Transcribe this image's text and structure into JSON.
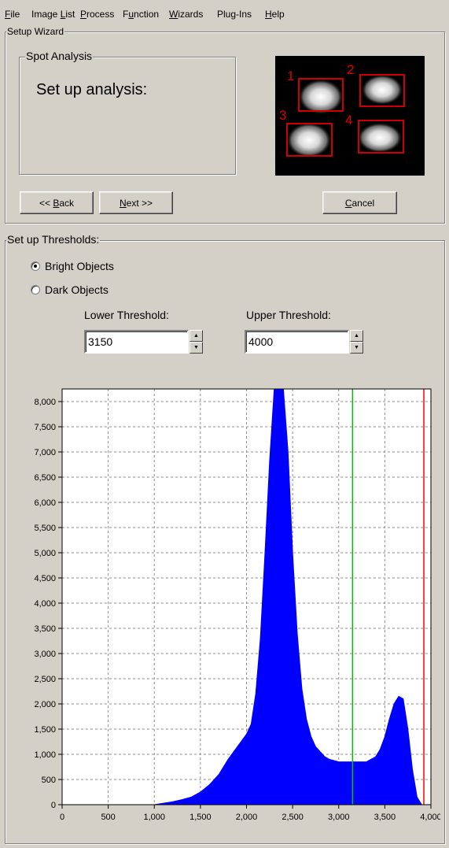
{
  "menu": [
    {
      "key": "file",
      "pre": "",
      "acc": "F",
      "post": "ile"
    },
    {
      "key": "image-list",
      "pre": "Image ",
      "acc": "L",
      "post": "ist"
    },
    {
      "key": "process",
      "pre": "",
      "acc": "P",
      "post": "rocess"
    },
    {
      "key": "function",
      "pre": "F",
      "acc": "u",
      "post": "nction"
    },
    {
      "key": "wizards",
      "pre": "",
      "acc": "W",
      "post": "izards"
    },
    {
      "key": "plugins",
      "pre": "Plug-Ins",
      "acc": "",
      "post": ""
    },
    {
      "key": "help",
      "pre": "",
      "acc": "H",
      "post": "elp"
    }
  ],
  "wizard": {
    "title": "Setup Wizard",
    "spot_group_title": "Spot Analysis",
    "instruction": "Set up analysis:",
    "preview_labels": [
      "1",
      "2",
      "3",
      "4"
    ],
    "back": {
      "pre": "<< ",
      "acc": "B",
      "post": "ack"
    },
    "next": {
      "pre": "",
      "acc": "N",
      "post": "ext >>"
    },
    "cancel": {
      "pre": "",
      "acc": "C",
      "post": "ancel"
    }
  },
  "thresholds": {
    "title": "Set up Thresholds:",
    "bright_label": "Bright Objects",
    "dark_label": "Dark Objects",
    "bright_selected": true,
    "lower_label": "Lower Threshold:",
    "upper_label": "Upper Threshold:",
    "lower_value": "3150",
    "upper_value": "4000"
  },
  "colors": {
    "histogram_fill": "#0000ff",
    "lower_line": "#00c000",
    "upper_line": "#ff0000",
    "preview_box": "#cc0000"
  },
  "chart_data": {
    "type": "area",
    "xlim": [
      0,
      4000
    ],
    "ylim": [
      0,
      8250
    ],
    "xticks": [
      0,
      500,
      1000,
      1500,
      2000,
      2500,
      3000,
      3500,
      4000
    ],
    "xtick_labels": [
      "0",
      "500",
      "1,000",
      "1,500",
      "2,000",
      "2,500",
      "3,000",
      "3,500",
      "4,000"
    ],
    "yticks": [
      0,
      500,
      1000,
      1500,
      2000,
      2500,
      3000,
      3500,
      4000,
      4500,
      5000,
      5500,
      6000,
      6500,
      7000,
      7500,
      8000
    ],
    "ytick_labels": [
      "0",
      "500",
      "1,000",
      "1,500",
      "2,000",
      "2,500",
      "3,000",
      "3,500",
      "4,000",
      "4,500",
      "5,000",
      "5,500",
      "6,000",
      "6,500",
      "7,000",
      "7,500",
      "8,000"
    ],
    "grid": true,
    "lower_threshold": 3150,
    "upper_threshold": 4000,
    "x": [
      0,
      1000,
      1100,
      1200,
      1300,
      1400,
      1500,
      1600,
      1700,
      1800,
      1900,
      2000,
      2050,
      2100,
      2150,
      2200,
      2250,
      2300,
      2350,
      2400,
      2450,
      2500,
      2550,
      2600,
      2650,
      2700,
      2750,
      2800,
      2850,
      2900,
      3000,
      3100,
      3200,
      3300,
      3400,
      3450,
      3500,
      3550,
      3600,
      3650,
      3700,
      3750,
      3800,
      3850,
      3900
    ],
    "y": [
      0,
      0,
      30,
      60,
      100,
      150,
      250,
      400,
      600,
      900,
      1150,
      1400,
      1600,
      2200,
      3300,
      5000,
      6800,
      8250,
      8250,
      8250,
      7000,
      5000,
      3400,
      2300,
      1700,
      1350,
      1150,
      1050,
      950,
      900,
      850,
      850,
      850,
      850,
      950,
      1100,
      1350,
      1700,
      2000,
      2150,
      2100,
      1500,
      700,
      150,
      0
    ]
  }
}
